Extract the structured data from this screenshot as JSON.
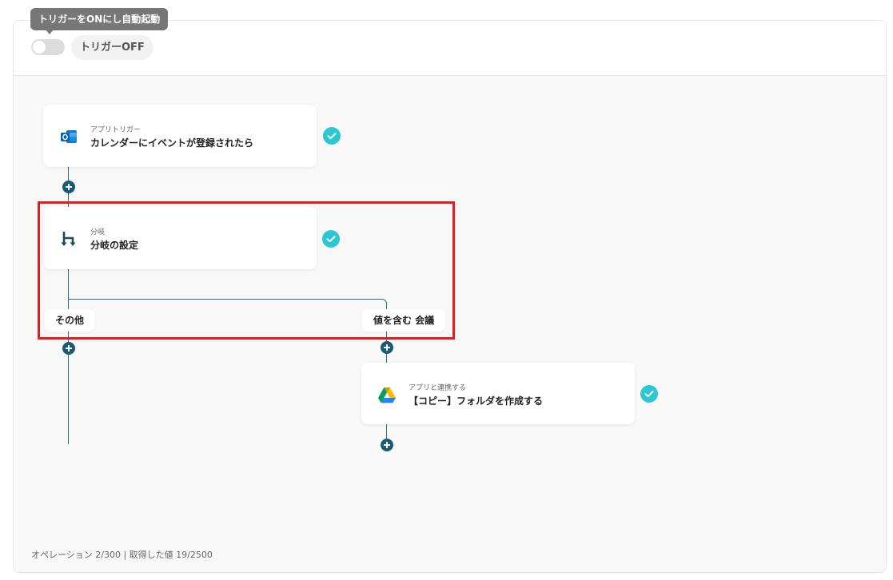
{
  "header": {
    "tooltip": "トリガーをONにし自動起動",
    "trigger_status": "トリガーOFF"
  },
  "flow": {
    "trigger_card": {
      "subtitle": "アプリトリガー",
      "title": "カレンダーにイベントが登録されたら",
      "icon": "outlook-icon"
    },
    "branch_card": {
      "subtitle": "分岐",
      "title": "分岐の設定",
      "icon": "branch-icon"
    },
    "branches": {
      "other_label": "その他",
      "match_label": "値を含む 会議"
    },
    "action_card": {
      "subtitle": "アプリと連携する",
      "title": "【コピー】フォルダを作成する",
      "icon": "google-drive-icon"
    }
  },
  "footer": {
    "operations": "オペレーション 2/300 | 取得した値 19/2500"
  },
  "colors": {
    "accent_check": "#2bc7d3",
    "flow_line": "#2a6a84",
    "highlight": "#e02020"
  }
}
